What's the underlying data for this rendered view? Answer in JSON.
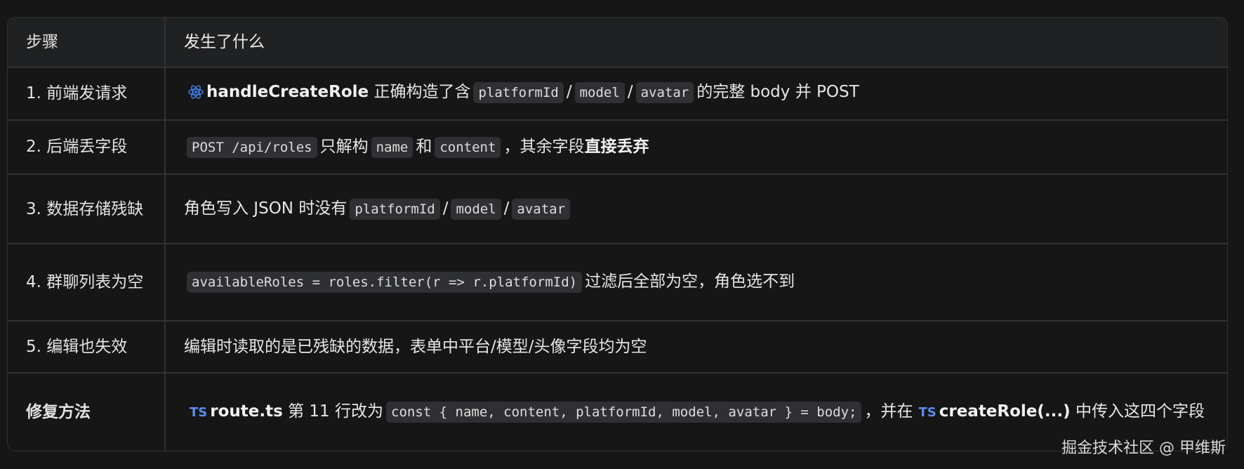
{
  "header": {
    "col1": "步骤",
    "col2": "发生了什么"
  },
  "rows": [
    {
      "step": "1. 前端发请求",
      "fn": "handleCreateRole",
      "t1": "正确构造了含",
      "c1": "platformId",
      "sep1": "/",
      "c2": "model",
      "sep2": "/",
      "c3": "avatar",
      "t2": "的完整 body 并 POST"
    },
    {
      "step": "2. 后端丢字段",
      "c1": "POST /api/roles",
      "t1": "只解构",
      "c2": "name",
      "t2": "和",
      "c3": "content",
      "t3": "，其余字段",
      "strong": "直接丢弃"
    },
    {
      "step": "3. 数据存储残缺",
      "t1": "角色写入 JSON 时没有",
      "c1": "platformId",
      "sep1": "/",
      "c2": "model",
      "sep2": "/",
      "c3": "avatar"
    },
    {
      "step": "4. 群聊列表为空",
      "c1": "availableRoles = roles.filter(r => r.platformId)",
      "t1": "过滤后全部为空，角色选不到"
    },
    {
      "step": "5. 编辑也失效",
      "t1": "编辑时读取的是已残缺的数据，表单中平台/模型/头像字段均为空"
    },
    {
      "step": "修复方法",
      "ts1": "TS",
      "file": "route.ts",
      "t1": "第 11 行改为",
      "c1": "const { name, content, platformId, model, avatar } = body;",
      "t2": "，并在",
      "ts2": "TS",
      "fn": "createRole(...)",
      "t3": "中传入这四个字段"
    }
  ],
  "watermark": "掘金技术社区 @ 甲维斯",
  "colors": {
    "background": "#161616",
    "header_bg": "#1f2123",
    "code_bg": "#2f3033",
    "ts_badge": "#5b8df0",
    "react_icon": "#3f7de8"
  },
  "icons": [
    "react-atom-icon",
    "typescript-icon"
  ]
}
